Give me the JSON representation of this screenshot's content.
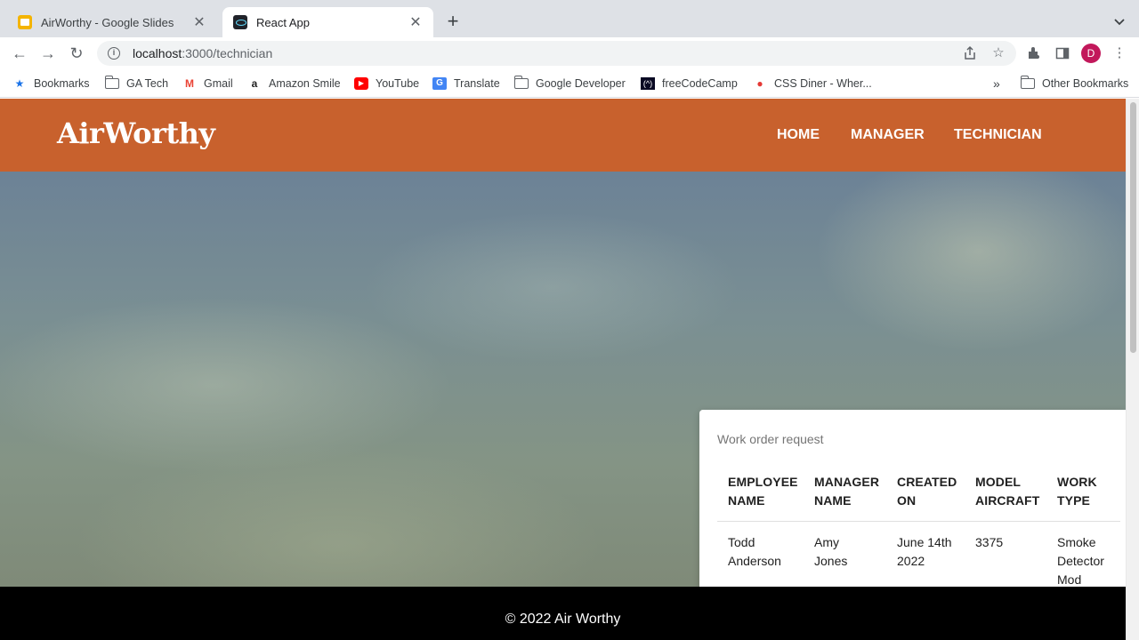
{
  "browser": {
    "tabs": [
      {
        "title": "AirWorthy - Google Slides",
        "icon": "google-slides-icon"
      },
      {
        "title": "React App",
        "icon": "react-icon"
      }
    ],
    "url_host": "localhost",
    "url_path": ":3000/technician",
    "profile_initial": "D",
    "bookmarks": [
      {
        "label": "Bookmarks",
        "icon": "star-icon"
      },
      {
        "label": "GA Tech",
        "icon": "folder-icon"
      },
      {
        "label": "Gmail",
        "icon": "gmail-icon"
      },
      {
        "label": "Amazon Smile",
        "icon": "amazon-icon"
      },
      {
        "label": "YouTube",
        "icon": "youtube-icon"
      },
      {
        "label": "Translate",
        "icon": "translate-icon"
      },
      {
        "label": "Google Developer",
        "icon": "folder-icon"
      },
      {
        "label": "freeCodeCamp",
        "icon": "freecodecamp-icon"
      },
      {
        "label": "CSS Diner - Wher...",
        "icon": "css-diner-icon"
      }
    ],
    "other_bookmarks": "Other Bookmarks"
  },
  "header": {
    "logo": "AirWorthy",
    "nav": [
      "HOME",
      "MANAGER",
      "TECHNICIAN"
    ],
    "color": "#c8612d"
  },
  "work_order": {
    "caption": "Work order request",
    "columns": [
      [
        "EMPLOYEE",
        "NAME"
      ],
      [
        "MANAGER",
        "NAME"
      ],
      [
        "CREATED",
        "ON"
      ],
      [
        "MODEL",
        "AIRCRAFT"
      ],
      [
        "WORK",
        "TYPE"
      ]
    ],
    "rows": [
      [
        [
          "Todd",
          "Anderson"
        ],
        [
          "Amy",
          "Jones"
        ],
        [
          "June 14th",
          "2022"
        ],
        [
          "3375"
        ],
        [
          "Smoke",
          "Detector",
          "Mod"
        ]
      ]
    ]
  },
  "footer": {
    "text": "© 2022 Air Worthy"
  }
}
